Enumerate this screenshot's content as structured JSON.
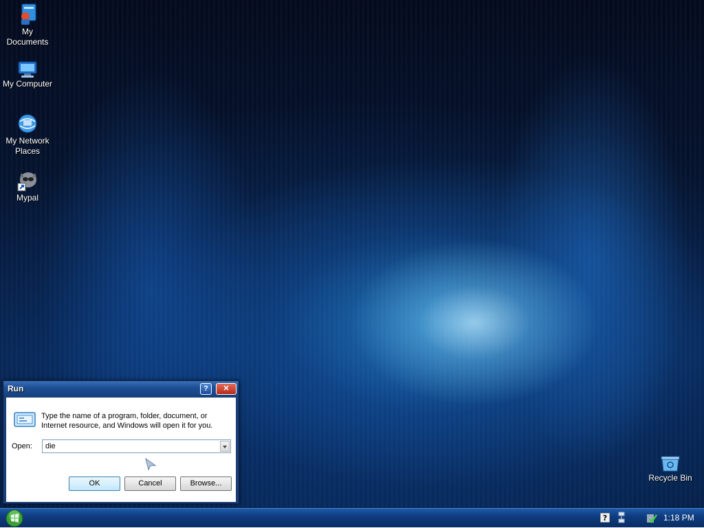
{
  "desktop": {
    "icons": [
      {
        "label": "My\nDocuments",
        "icon": "my-documents-icon"
      },
      {
        "label": "My Computer",
        "icon": "my-computer-icon"
      },
      {
        "label": "My Network\nPlaces",
        "icon": "network-places-icon"
      },
      {
        "label": "Mypal",
        "icon": "mypal-icon"
      },
      {
        "label": "Recycle Bin",
        "icon": "recycle-bin-icon"
      }
    ]
  },
  "run_dialog": {
    "title": "Run",
    "help_glyph": "?",
    "close_glyph": "✕",
    "description": "Type the name of a program, folder, document, or Internet resource, and Windows will open it for you.",
    "open_label": "Open:",
    "open_value": "die",
    "ok_label": "OK",
    "cancel_label": "Cancel",
    "browse_label": "Browse..."
  },
  "taskbar": {
    "clock": "1:18 PM",
    "tray_help_glyph": "?"
  },
  "colors": {
    "taskbar": "#0f3c7f",
    "titlebar": "#1e4f94",
    "close": "#b52b18"
  }
}
